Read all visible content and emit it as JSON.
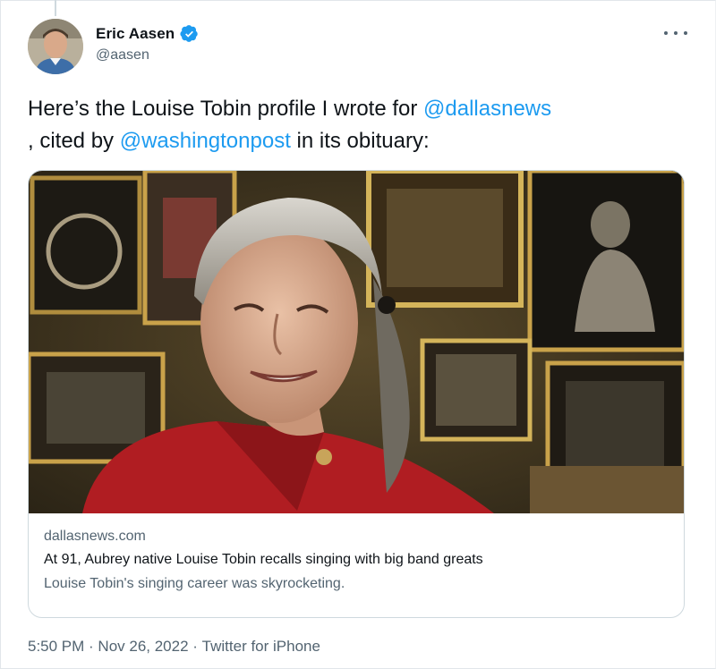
{
  "author": {
    "display_name": "Eric Aasen",
    "handle": "@aasen",
    "verified": true,
    "verified_color": "#1d9bf0"
  },
  "menu": {
    "icon": "more-horizontal-icon"
  },
  "tweet": {
    "text_part1": "Here’s the Louise Tobin profile I wrote for ",
    "mention1": "@dallasnews",
    "text_part2": ", cited by ",
    "mention2": "@washingtonpost",
    "text_part3": " in its obituary:"
  },
  "link_card": {
    "domain": "dallasnews.com",
    "title": "At 91, Aubrey native Louise Tobin recalls singing with big band greats",
    "description": "Louise Tobin's singing career was skyrocketing."
  },
  "meta": {
    "time": "5:50 PM",
    "separator": " · ",
    "date": "Nov 26, 2022",
    "separator2": " · ",
    "source": "Twitter for iPhone"
  },
  "colors": {
    "link": "#1d9bf0",
    "text": "#0f1419",
    "secondary": "#536471"
  }
}
